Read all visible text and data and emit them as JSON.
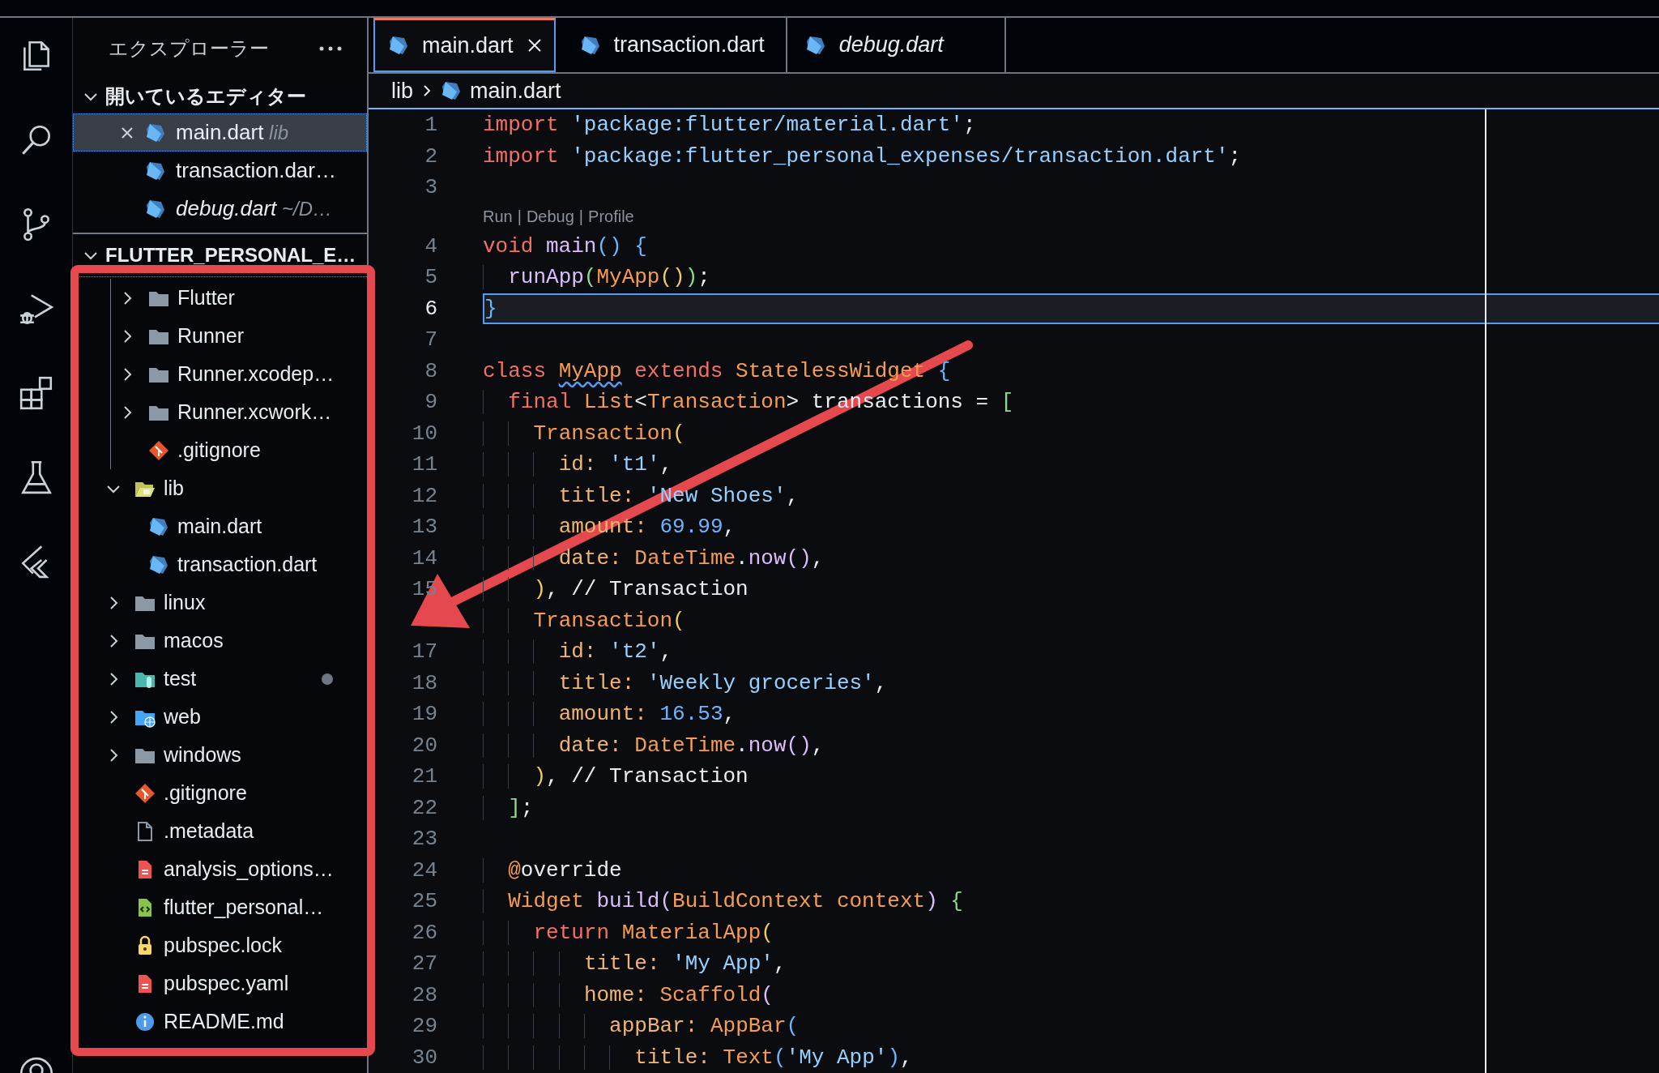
{
  "explorer": {
    "title": "エクスプローラー",
    "open_editors": {
      "label": "開いているエディター",
      "expanded": true,
      "items": [
        {
          "name": "main.dart",
          "description": "lib",
          "selected": true,
          "preview": false
        },
        {
          "name": "transaction.dar…",
          "selected": false,
          "preview": false
        },
        {
          "name": "debug.dart",
          "description": "~/D…",
          "selected": false,
          "preview": true
        }
      ]
    },
    "project": {
      "label": "FLUTTER_PERSONAL_E…",
      "expanded": true,
      "children": [
        {
          "kind": "continuation",
          "children": [
            {
              "name": "Flutter",
              "kind": "folder",
              "expanded": false,
              "dot": false
            },
            {
              "name": "Runner",
              "kind": "folder",
              "expanded": false,
              "dot": false
            },
            {
              "name": "Runner.xcodep…",
              "kind": "folder",
              "expanded": false,
              "dot": false
            },
            {
              "name": "Runner.xcwork…",
              "kind": "folder",
              "expanded": false,
              "dot": false
            },
            {
              "name": ".gitignore",
              "kind": "git",
              "dot": false
            }
          ]
        },
        {
          "name": "lib",
          "kind": "lib-folder",
          "expanded": true,
          "dot": false,
          "children": [
            {
              "name": "main.dart",
              "kind": "dart",
              "dot": false
            },
            {
              "name": "transaction.dart",
              "kind": "dart",
              "dot": false
            }
          ]
        },
        {
          "name": "linux",
          "kind": "folder",
          "expanded": false,
          "dot": false
        },
        {
          "name": "macos",
          "kind": "folder",
          "expanded": false,
          "dot": false
        },
        {
          "name": "test",
          "kind": "test-folder",
          "expanded": false,
          "dot": true
        },
        {
          "name": "web",
          "kind": "web-folder",
          "expanded": false,
          "dot": false
        },
        {
          "name": "windows",
          "kind": "folder",
          "expanded": false,
          "dot": false
        },
        {
          "name": ".gitignore",
          "kind": "git",
          "dot": false
        },
        {
          "name": ".metadata",
          "kind": "plain",
          "dot": false
        },
        {
          "name": "analysis_options…",
          "kind": "yaml",
          "dot": false
        },
        {
          "name": "flutter_personal…",
          "kind": "xml",
          "dot": false
        },
        {
          "name": "pubspec.lock",
          "kind": "lock",
          "dot": false
        },
        {
          "name": "pubspec.yaml",
          "kind": "yaml",
          "dot": false
        },
        {
          "name": "README.md",
          "kind": "info",
          "dot": false
        }
      ]
    }
  },
  "tabs": [
    {
      "name": "main.dart",
      "selected": true,
      "preview": false
    },
    {
      "name": "transaction.dart",
      "selected": false,
      "preview": false
    },
    {
      "name": "debug.dart",
      "selected": false,
      "preview": true
    }
  ],
  "breadcrumb": [
    {
      "text": "lib",
      "kind": "folder"
    },
    {
      "text": "main.dart",
      "kind": "dart"
    }
  ],
  "code": {
    "lines": [
      {
        "number": "1",
        "current": false,
        "tokens": [
          {
            "kind": "kw",
            "text": "import "
          },
          {
            "kind": "str",
            "text": "'package:flutter/material.dart'"
          },
          {
            "kind": "plain",
            "text": ";"
          }
        ]
      },
      {
        "number": "2",
        "current": false,
        "tokens": [
          {
            "kind": "kw",
            "text": "import "
          },
          {
            "kind": "str",
            "text": "'package:flutter_personal_expenses/transaction.dart'"
          },
          {
            "kind": "plain",
            "text": ";"
          }
        ]
      },
      {
        "number": "3",
        "current": false
      },
      {
        "number": "4",
        "current": false,
        "codelens": {
          "links": [
            "Run",
            "Debug",
            "Profile"
          ],
          "separator": "|"
        },
        "tokens": [
          {
            "kind": "kw",
            "text": "void "
          },
          {
            "kind": "fn",
            "text": "main"
          },
          {
            "kind": "b1",
            "text": "() {"
          }
        ]
      },
      {
        "number": "5",
        "current": false,
        "tokens": [
          {
            "kind": "fn",
            "text": "  runApp"
          },
          {
            "kind": "b2",
            "text": "("
          },
          {
            "kind": "type",
            "text": "MyApp"
          },
          {
            "kind": "b3",
            "text": "()"
          },
          {
            "kind": "b2",
            "text": ")"
          },
          {
            "kind": "plain",
            "text": ";"
          }
        ]
      },
      {
        "number": "6",
        "current": true,
        "tokens": [
          {
            "kind": "b1",
            "text": "}"
          }
        ]
      },
      {
        "number": "7",
        "current": false
      },
      {
        "number": "8",
        "current": false,
        "tokens": [
          {
            "kind": "kw",
            "text": "class "
          },
          {
            "kind": "type-warn",
            "text": "MyApp"
          },
          {
            "kind": "kw",
            "text": " extends "
          },
          {
            "kind": "type",
            "text": "StatelessWidget"
          },
          {
            "kind": "b1",
            "text": " {"
          }
        ]
      },
      {
        "number": "9",
        "current": false,
        "tokens": [
          {
            "kind": "kw",
            "text": "  final "
          },
          {
            "kind": "type",
            "text": "List"
          },
          {
            "kind": "plain",
            "text": "<"
          },
          {
            "kind": "type",
            "text": "Transaction"
          },
          {
            "kind": "plain",
            "text": "> transactions = "
          },
          {
            "kind": "b2",
            "text": "["
          }
        ]
      },
      {
        "number": "10",
        "current": false,
        "tokens": [
          {
            "kind": "type",
            "text": "    Transaction"
          },
          {
            "kind": "b3",
            "text": "("
          }
        ]
      },
      {
        "number": "11",
        "current": false,
        "tokens": [
          {
            "kind": "prop",
            "text": "      id: "
          },
          {
            "kind": "str",
            "text": "'t1'"
          },
          {
            "kind": "plain",
            "text": ","
          }
        ]
      },
      {
        "number": "12",
        "current": false,
        "tokens": [
          {
            "kind": "prop",
            "text": "      title: "
          },
          {
            "kind": "str",
            "text": "'New Shoes'"
          },
          {
            "kind": "plain",
            "text": ","
          }
        ]
      },
      {
        "number": "13",
        "current": false,
        "tokens": [
          {
            "kind": "prop",
            "text": "      amount: "
          },
          {
            "kind": "num",
            "text": "69.99"
          },
          {
            "kind": "plain",
            "text": ","
          }
        ]
      },
      {
        "number": "14",
        "current": false,
        "tokens": [
          {
            "kind": "prop",
            "text": "      date: "
          },
          {
            "kind": "type",
            "text": "DateTime"
          },
          {
            "kind": "plain",
            "text": "."
          },
          {
            "kind": "fn",
            "text": "now"
          },
          {
            "kind": "b4",
            "text": "()"
          },
          {
            "kind": "plain",
            "text": ","
          }
        ]
      },
      {
        "number": "15",
        "current": false,
        "tokens": [
          {
            "kind": "b3",
            "text": "    )"
          },
          {
            "kind": "plain",
            "text": ", // Transaction"
          }
        ]
      },
      {
        "current": false,
        "tokens": [
          {
            "kind": "type",
            "text": "    Transaction"
          },
          {
            "kind": "b3",
            "text": "("
          }
        ]
      },
      {
        "number": "17",
        "current": false,
        "tokens": [
          {
            "kind": "prop",
            "text": "      id: "
          },
          {
            "kind": "str",
            "text": "'t2'"
          },
          {
            "kind": "plain",
            "text": ","
          }
        ]
      },
      {
        "number": "18",
        "current": false,
        "tokens": [
          {
            "kind": "prop",
            "text": "      title: "
          },
          {
            "kind": "str",
            "text": "'Weekly groceries'"
          },
          {
            "kind": "plain",
            "text": ","
          }
        ]
      },
      {
        "number": "19",
        "current": false,
        "tokens": [
          {
            "kind": "prop",
            "text": "      amount: "
          },
          {
            "kind": "num",
            "text": "16.53"
          },
          {
            "kind": "plain",
            "text": ","
          }
        ]
      },
      {
        "number": "20",
        "current": false,
        "tokens": [
          {
            "kind": "prop",
            "text": "      date: "
          },
          {
            "kind": "type",
            "text": "DateTime"
          },
          {
            "kind": "plain",
            "text": "."
          },
          {
            "kind": "fn",
            "text": "now"
          },
          {
            "kind": "b4",
            "text": "()"
          },
          {
            "kind": "plain",
            "text": ","
          }
        ]
      },
      {
        "number": "21",
        "current": false,
        "tokens": [
          {
            "kind": "b3",
            "text": "    )"
          },
          {
            "kind": "plain",
            "text": ", // Transaction"
          }
        ]
      },
      {
        "number": "22",
        "current": false,
        "tokens": [
          {
            "kind": "b2",
            "text": "  ]"
          },
          {
            "kind": "plain",
            "text": ";"
          }
        ]
      },
      {
        "number": "23",
        "current": false
      },
      {
        "number": "24",
        "current": false,
        "tokens": [
          {
            "kind": "type",
            "text": "  @"
          },
          {
            "kind": "plain",
            "text": "override"
          }
        ]
      },
      {
        "number": "25",
        "current": false,
        "tokens": [
          {
            "kind": "type",
            "text": "  Widget "
          },
          {
            "kind": "fn",
            "text": "build"
          },
          {
            "kind": "b4",
            "text": "("
          },
          {
            "kind": "type",
            "text": "BuildContext context"
          },
          {
            "kind": "b4",
            "text": ")"
          },
          {
            "kind": "b2",
            "text": " {"
          }
        ]
      },
      {
        "number": "26",
        "current": false,
        "tokens": [
          {
            "kind": "kw",
            "text": "    return "
          },
          {
            "kind": "type",
            "text": "MaterialApp"
          },
          {
            "kind": "b3",
            "text": "("
          }
        ]
      },
      {
        "number": "27",
        "current": false,
        "tokens": [
          {
            "kind": "prop",
            "text": "        title: "
          },
          {
            "kind": "str",
            "text": "'My App'"
          },
          {
            "kind": "plain",
            "text": ","
          }
        ]
      },
      {
        "number": "28",
        "current": false,
        "tokens": [
          {
            "kind": "prop",
            "text": "        home: "
          },
          {
            "kind": "type",
            "text": "Scaffold"
          },
          {
            "kind": "b4",
            "text": "("
          }
        ]
      },
      {
        "number": "29",
        "current": false,
        "tokens": [
          {
            "kind": "prop",
            "text": "          appBar: "
          },
          {
            "kind": "type",
            "text": "AppBar"
          },
          {
            "kind": "b1",
            "text": "("
          }
        ]
      },
      {
        "number": "30",
        "current": false,
        "tokens": [
          {
            "kind": "prop",
            "text": "            title: "
          },
          {
            "kind": "type",
            "text": "Text"
          },
          {
            "kind": "b1",
            "text": "("
          },
          {
            "kind": "str",
            "text": "'My App'"
          },
          {
            "kind": "b1",
            "text": ")"
          },
          {
            "kind": "plain",
            "text": ","
          }
        ]
      }
    ]
  }
}
